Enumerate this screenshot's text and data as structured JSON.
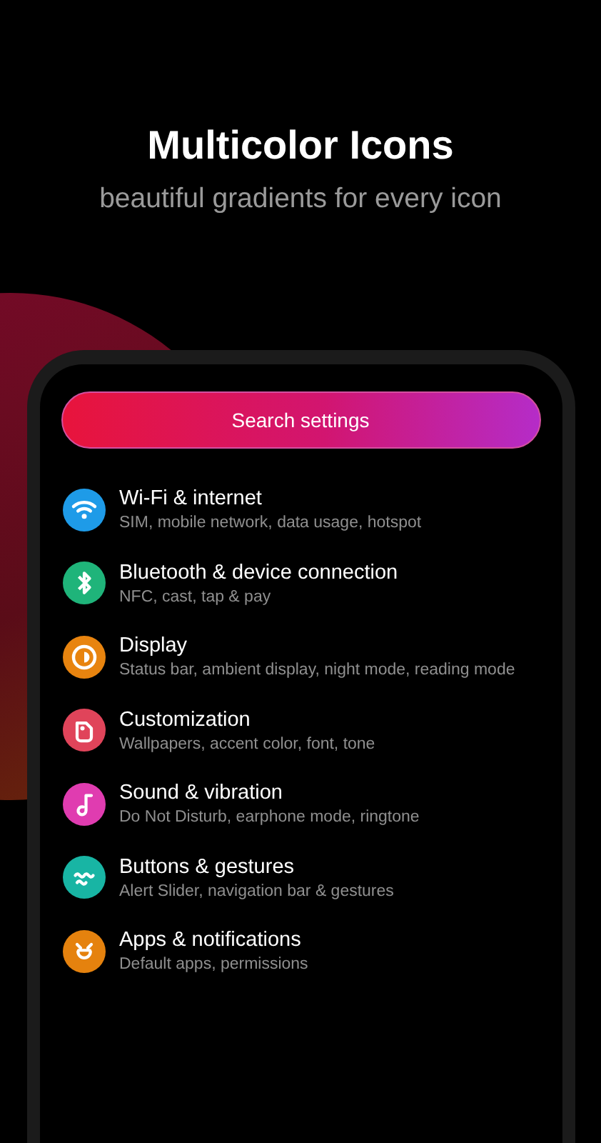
{
  "headline": {
    "title": "Multicolor Icons",
    "subtitle": "beautiful gradients for every icon"
  },
  "search": {
    "placeholder": "Search settings"
  },
  "settings": [
    {
      "title": "Wi-Fi & internet",
      "summary": "SIM, mobile network, data usage, hotspot",
      "color": "#1e9be8"
    },
    {
      "title": "Bluetooth & device connection",
      "summary": "NFC, cast, tap & pay",
      "color": "#1fb47a"
    },
    {
      "title": "Display",
      "summary": "Status bar, ambient display, night mode, reading mode",
      "color": "#e8840f"
    },
    {
      "title": "Customization",
      "summary": "Wallpapers, accent color, font, tone",
      "color": "#e0445a"
    },
    {
      "title": "Sound & vibration",
      "summary": "Do Not Disturb, earphone mode, ringtone",
      "color": "#e03cb0"
    },
    {
      "title": "Buttons & gestures",
      "summary": "Alert Slider, navigation bar & gestures",
      "color": "#18b5a4"
    },
    {
      "title": "Apps & notifications",
      "summary": "Default apps, permissions",
      "color": "#e5820e"
    }
  ]
}
